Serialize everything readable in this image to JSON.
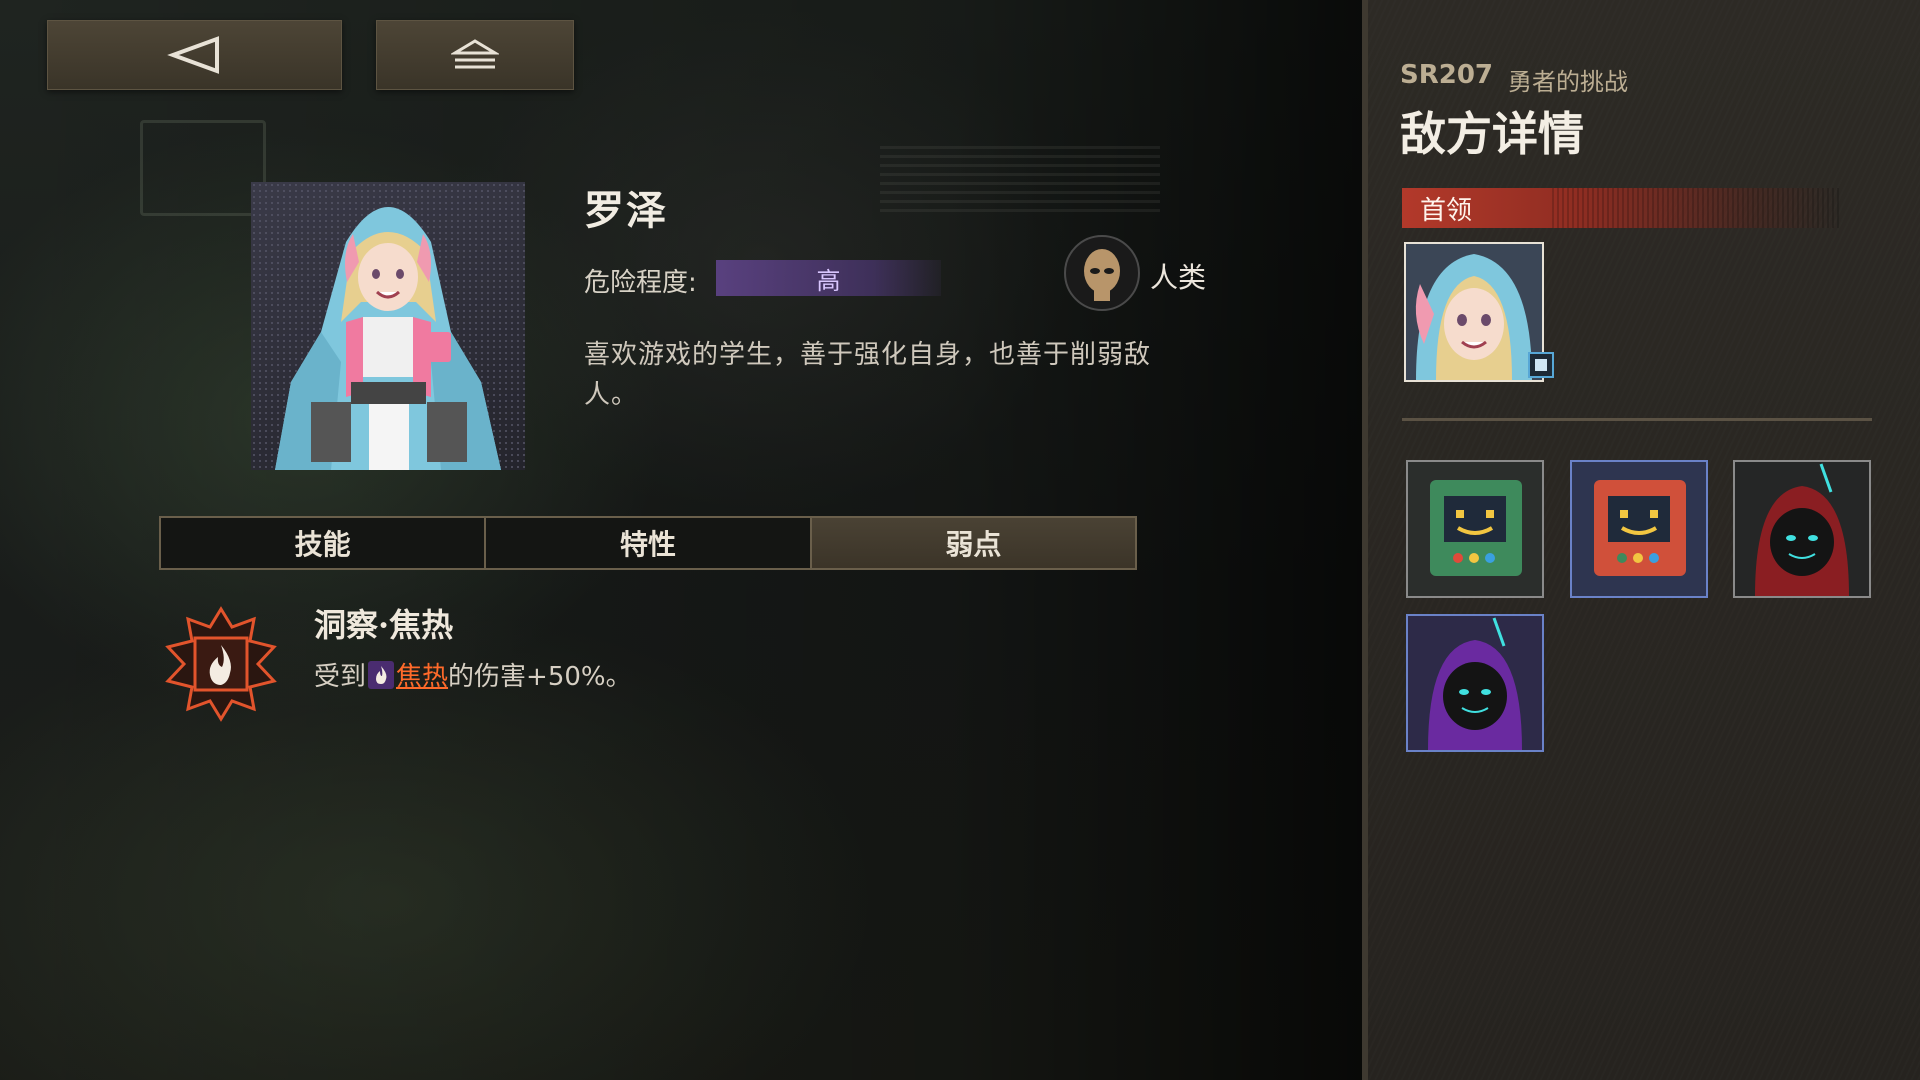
{
  "nav": {
    "back_icon": "back-triangle-icon",
    "home_icon": "home-eject-icon"
  },
  "enemy": {
    "name": "罗泽",
    "danger_label": "危险程度:",
    "danger_value": "高",
    "race": "人类",
    "description": "喜欢游戏的学生，善于强化自身，也善于削弱敌人。"
  },
  "tabs": [
    {
      "label": "技能",
      "active": false
    },
    {
      "label": "特性",
      "active": false
    },
    {
      "label": "弱点",
      "active": true
    }
  ],
  "weakness": {
    "title": "洞察·焦热",
    "prefix": "受到",
    "element": "焦热",
    "suffix": "的伤害+50%。",
    "icon": "fire-icon"
  },
  "panel": {
    "stage_code": "SR207",
    "stage_name": "勇者的挑战",
    "title": "敌方详情",
    "boss_label": "首领"
  },
  "minions": [
    {
      "icon": "arcade-robot-green-icon"
    },
    {
      "icon": "arcade-robot-red-icon"
    },
    {
      "icon": "hooded-bunny-red-icon"
    },
    {
      "icon": "hooded-bunny-purple-icon"
    }
  ],
  "colors": {
    "accent": "#b3392a",
    "danger": "#5c4284",
    "burn": "#ff6a2a",
    "tab_active": "#4a4234"
  }
}
